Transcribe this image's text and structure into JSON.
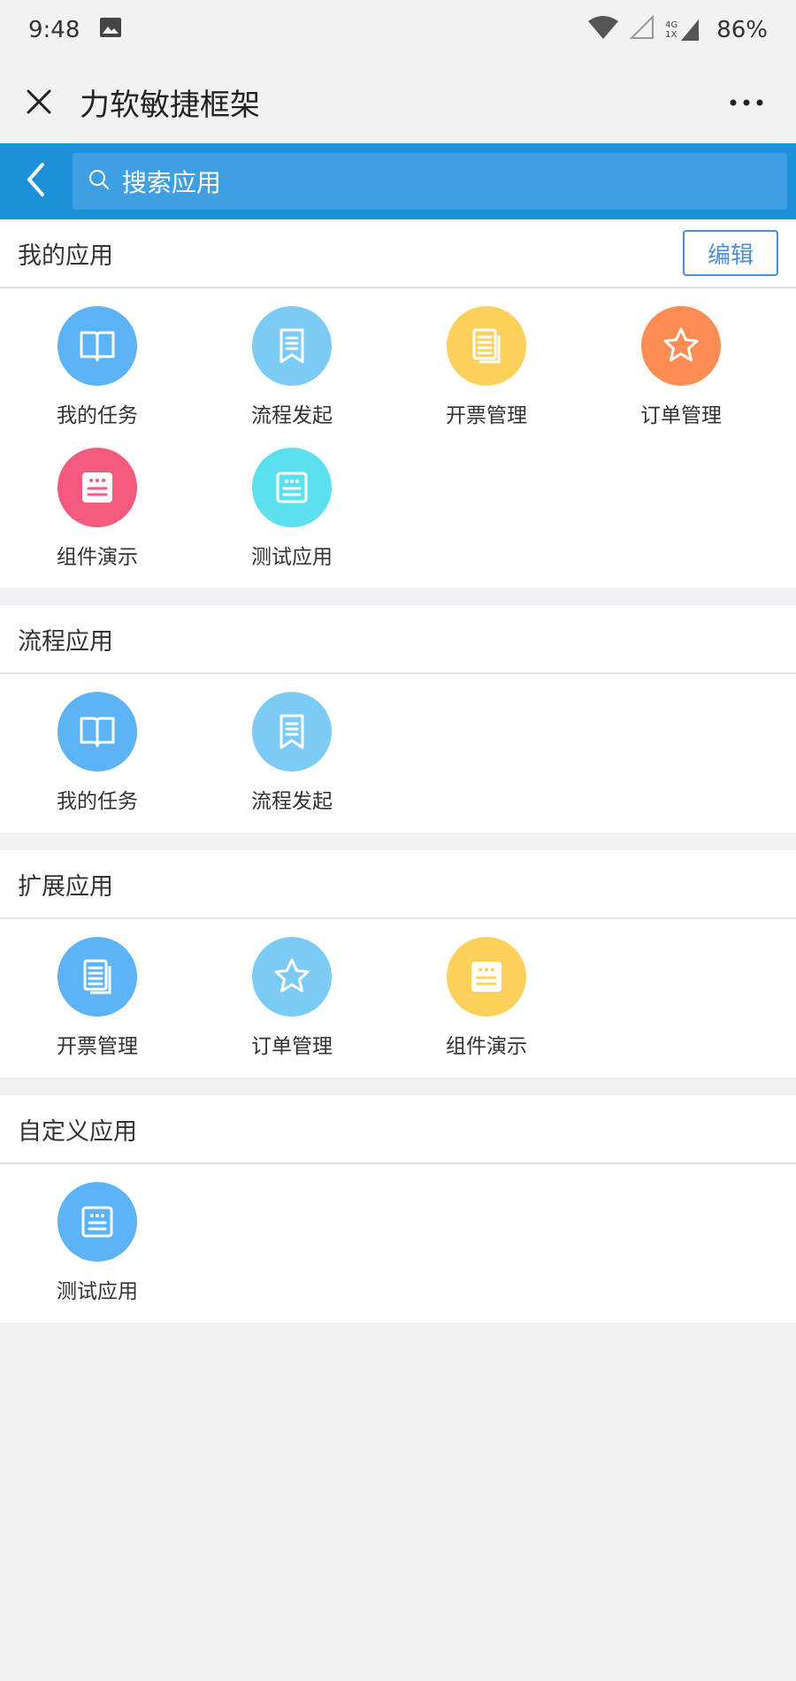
{
  "status_bar": {
    "time": "9:48",
    "network": "4G",
    "sim": "1X",
    "battery": "86%"
  },
  "title_bar": {
    "title": "力软敏捷框架"
  },
  "search": {
    "placeholder": "搜索应用"
  },
  "sections": [
    {
      "title": "我的应用",
      "edit_label": "编辑",
      "apps": [
        {
          "label": "我的任务",
          "icon": "book-icon",
          "color": "#5cb3f5"
        },
        {
          "label": "流程发起",
          "icon": "bookmark-icon",
          "color": "#7ccbf6"
        },
        {
          "label": "开票管理",
          "icon": "document-icon",
          "color": "#fbd15b"
        },
        {
          "label": "订单管理",
          "icon": "star-icon",
          "color": "#fd8d54"
        },
        {
          "label": "组件演示",
          "icon": "form-icon",
          "color": "#f35a7e"
        },
        {
          "label": "测试应用",
          "icon": "form-icon",
          "color": "#5be0ef"
        }
      ]
    },
    {
      "title": "流程应用",
      "apps": [
        {
          "label": "我的任务",
          "icon": "book-icon",
          "color": "#5cb3f5"
        },
        {
          "label": "流程发起",
          "icon": "bookmark-icon",
          "color": "#7ccbf6"
        }
      ]
    },
    {
      "title": "扩展应用",
      "apps": [
        {
          "label": "开票管理",
          "icon": "document-icon",
          "color": "#5cb3f5"
        },
        {
          "label": "订单管理",
          "icon": "star-icon",
          "color": "#7ccbf6"
        },
        {
          "label": "组件演示",
          "icon": "form-icon",
          "color": "#fbd15b"
        }
      ]
    },
    {
      "title": "自定义应用",
      "apps": [
        {
          "label": "测试应用",
          "icon": "form-icon",
          "color": "#5cb3f5"
        }
      ]
    }
  ]
}
